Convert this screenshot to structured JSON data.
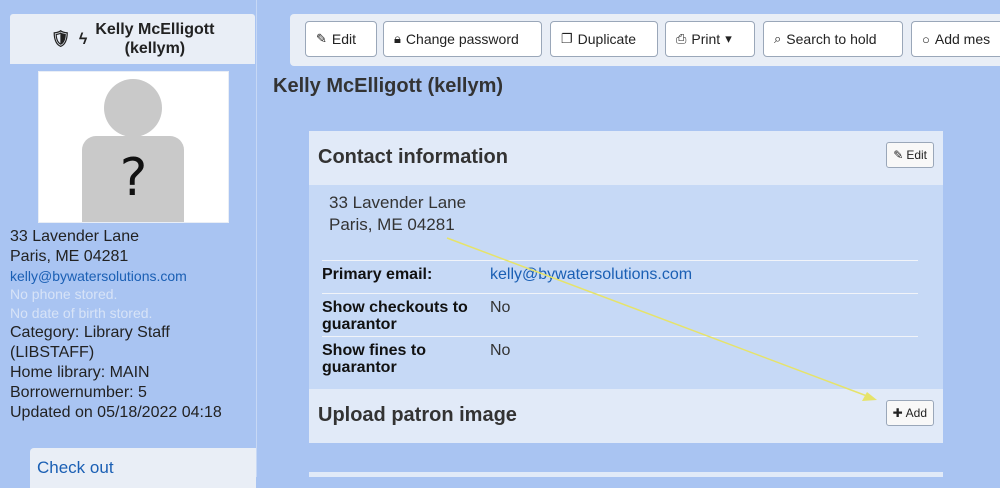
{
  "sidebar": {
    "patron_name": "Kelly McElligott",
    "patron_userid": "(kellym)",
    "photo_placeholder": "?",
    "address_line1": "33 Lavender Lane",
    "address_line2": "Paris, ME 04281",
    "email": "kelly@bywatersolutions.com",
    "no_phone": "No phone stored.",
    "no_dob": "No date of birth stored.",
    "category": "Category: Library Staff",
    "category_code": "(LIBSTAFF)",
    "home_library": "Home library: MAIN",
    "borrowernumber": "Borrowernumber: 5",
    "updated": "Updated on 05/18/2022 04:18",
    "checkout_tab": "Check out"
  },
  "toolbar": {
    "edit": "Edit",
    "change_password": "Change password",
    "duplicate": "Duplicate",
    "print": "Print",
    "search_to_hold": "Search to hold",
    "add_message": "Add mes"
  },
  "main": {
    "title": "Kelly McElligott (kellym)",
    "contact": {
      "heading": "Contact information",
      "edit_label": "Edit",
      "address_line1": "33 Lavender Lane",
      "address_line2": "Paris, ME 04281",
      "rows": [
        {
          "label": "Primary email:",
          "value": "kelly@bywatersolutions.com"
        },
        {
          "label": "Show checkouts to guarantor",
          "value": "No"
        },
        {
          "label": "Show fines to guarantor",
          "value": "No"
        }
      ]
    },
    "upload": {
      "heading": "Upload patron image",
      "add_label": "Add"
    }
  },
  "colors": {
    "page_bg": "#a9c4f2",
    "panel_header": "#e1eaf8",
    "link": "#1a5fb4",
    "annotation_arrow": "#e6e36a"
  },
  "icons": [
    "shield-icon",
    "bolt-icon",
    "pencil-icon",
    "lock-icon",
    "duplicate-icon",
    "printer-icon",
    "caret-down-icon",
    "search-icon",
    "comment-icon",
    "plus-icon"
  ]
}
